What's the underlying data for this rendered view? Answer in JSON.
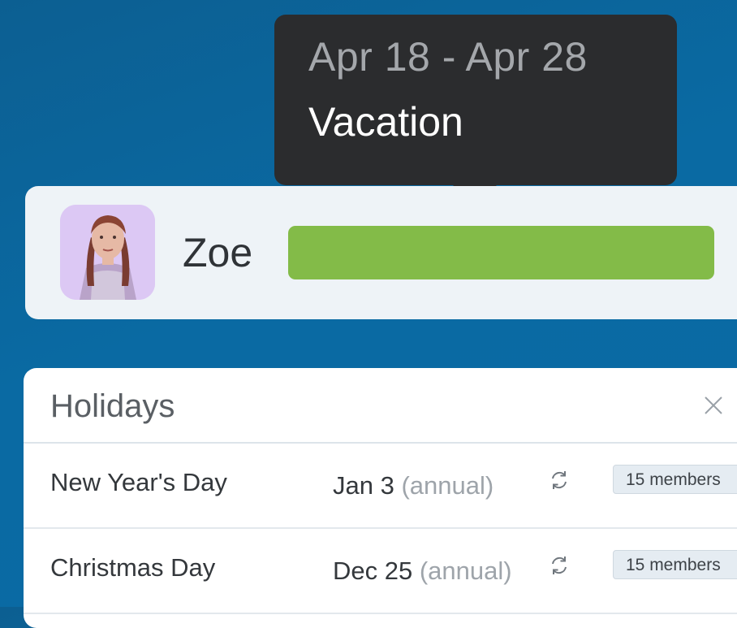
{
  "tooltip": {
    "dates": "Apr 18 - Apr 28",
    "type": "Vacation"
  },
  "user": {
    "name": "Zoe",
    "vacation_color": "#83bb48",
    "avatar_bg": "#dcc8f4"
  },
  "holidays": {
    "title": "Holidays",
    "rows": [
      {
        "name": "New Year's Day",
        "date": "Jan 3",
        "recurrence": "(annual)",
        "members": "15 members"
      },
      {
        "name": "Christmas Day",
        "date": "Dec 25",
        "recurrence": "(annual)",
        "members": "15 members"
      }
    ]
  },
  "colors": {
    "background": "#0b6aa4",
    "tooltip_bg": "#2b2c2e"
  }
}
